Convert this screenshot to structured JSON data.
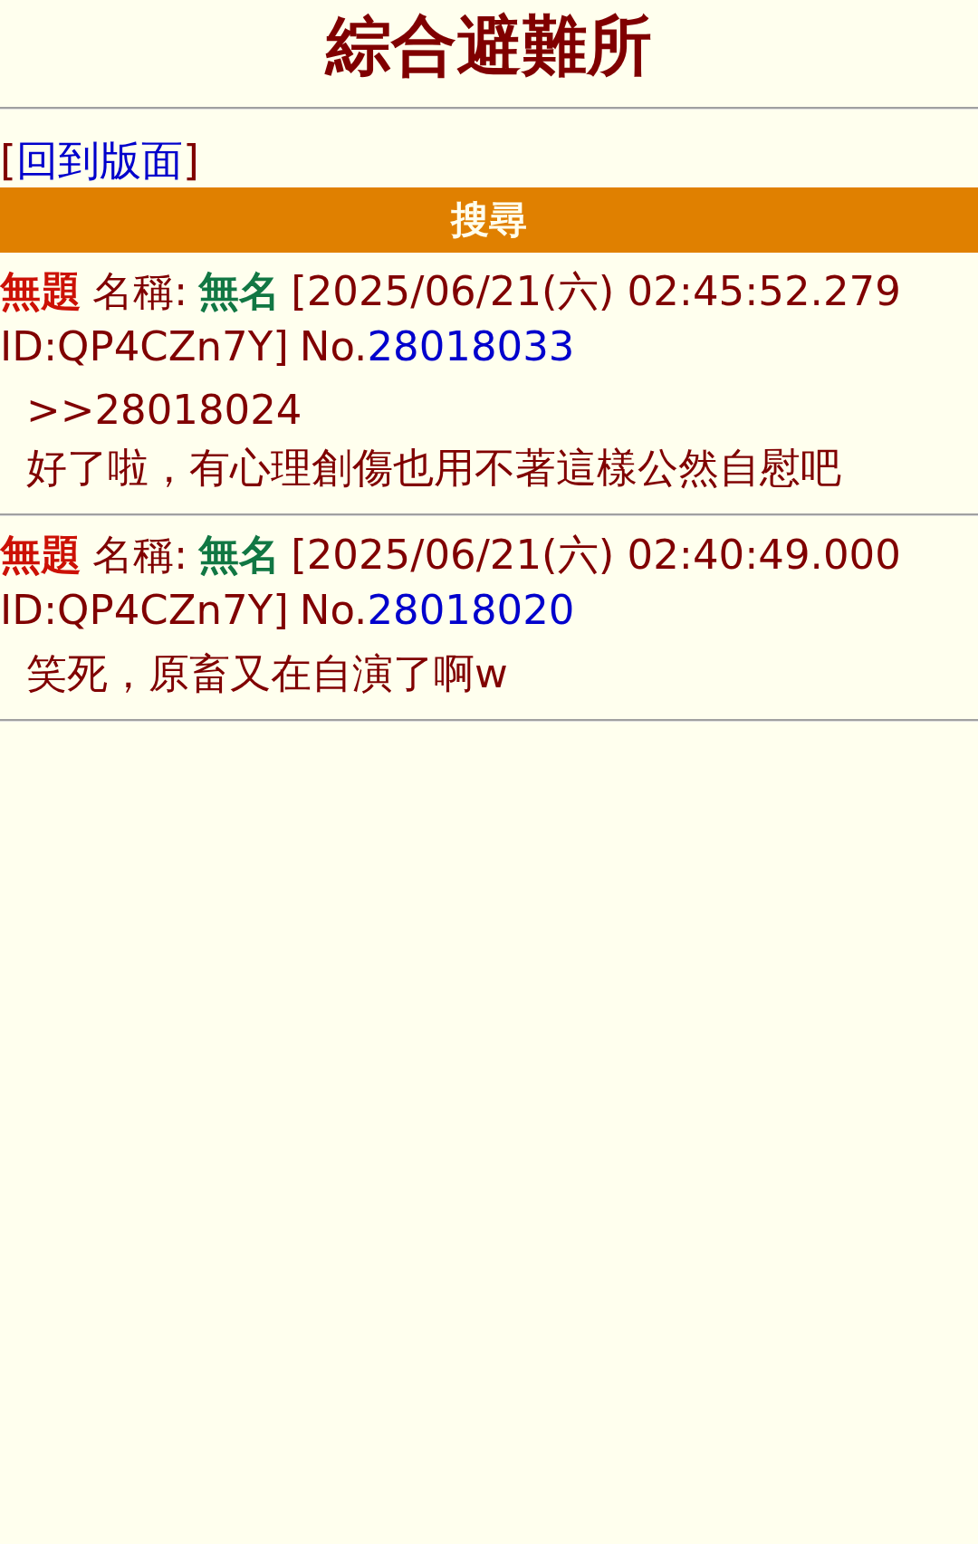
{
  "title": "綜合避難所",
  "back_link": {
    "open": "[",
    "label": "回到版面",
    "close": "]"
  },
  "search_bar": {
    "label": "搜尋"
  },
  "posts": [
    {
      "subject": "無題",
      "name_label": "名稱:",
      "name": "無名",
      "datetime": "[2025/06/21(六) 02:45:52.279",
      "id": "ID:QP4CZn7Y]",
      "no_label": "No.",
      "number": "28018033",
      "lines": [
        ">>28018024",
        "好了啦，有心理創傷也用不著這樣公然自慰吧"
      ]
    },
    {
      "subject": "無題",
      "name_label": "名稱:",
      "name": "無名",
      "datetime": "[2025/06/21(六) 02:40:49.000",
      "id": "ID:QP4CZn7Y]",
      "no_label": "No.",
      "number": "28018020",
      "lines": [
        "笑死，原畜又在自演了啊w"
      ]
    }
  ]
}
